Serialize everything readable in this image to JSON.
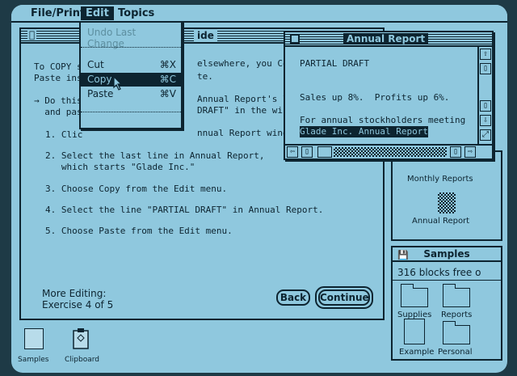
{
  "menubar": {
    "file_print": "File/Print",
    "edit": "Edit",
    "topics": "Topics"
  },
  "edit_menu": {
    "undo": "Undo Last Change",
    "cut": "Cut",
    "cut_key": "⌘X",
    "copy": "Copy",
    "copy_key": "⌘C",
    "paste": "Paste",
    "paste_key": "⌘V"
  },
  "main_window": {
    "title": "ide",
    "intro_l1": "To COPY s",
    "intro_l1b": "elsewhere, you Co",
    "intro_l2": "Paste ins",
    "intro_l2b": "te.",
    "bullet_l1": "→ Do this",
    "bullet_l1b": "Annual Report's la",
    "bullet_l2": "  and pas",
    "bullet_l2b": "DRAFT\" in the win",
    "step1": "1. Clic",
    "step1b": "nnual Report windo",
    "step2_l1": "2. Select the last line in Annual Report,",
    "step2_l2": "   which starts \"Glade Inc.\"",
    "step3": "3. Choose Copy from the Edit menu.",
    "step4": "4. Select the line \"PARTIAL DRAFT\" in Annual Report.",
    "step5": "5. Choose Paste from the Edit menu.",
    "footer_l1": "More Editing:",
    "footer_l2": "Exercise 4 of 5",
    "back_label": "Back",
    "continue_label": "Continue"
  },
  "annual_report": {
    "title": "Annual Report",
    "line1": "PARTIAL DRAFT",
    "line2": "Sales up 8%.  Profits up 6%.",
    "line3": "For annual stockholders meeting",
    "line4": "Glade Inc. Annual Report"
  },
  "monthly_window": {
    "item1": "Monthly Reports",
    "item2": "Annual Report"
  },
  "samples_window": {
    "title": "Samples",
    "free": "316 blocks free o",
    "icons": [
      "Supplies",
      "Reports",
      "Example",
      "Personal"
    ]
  },
  "desktop": {
    "samples": "Samples",
    "clipboard": "Clipboard"
  }
}
